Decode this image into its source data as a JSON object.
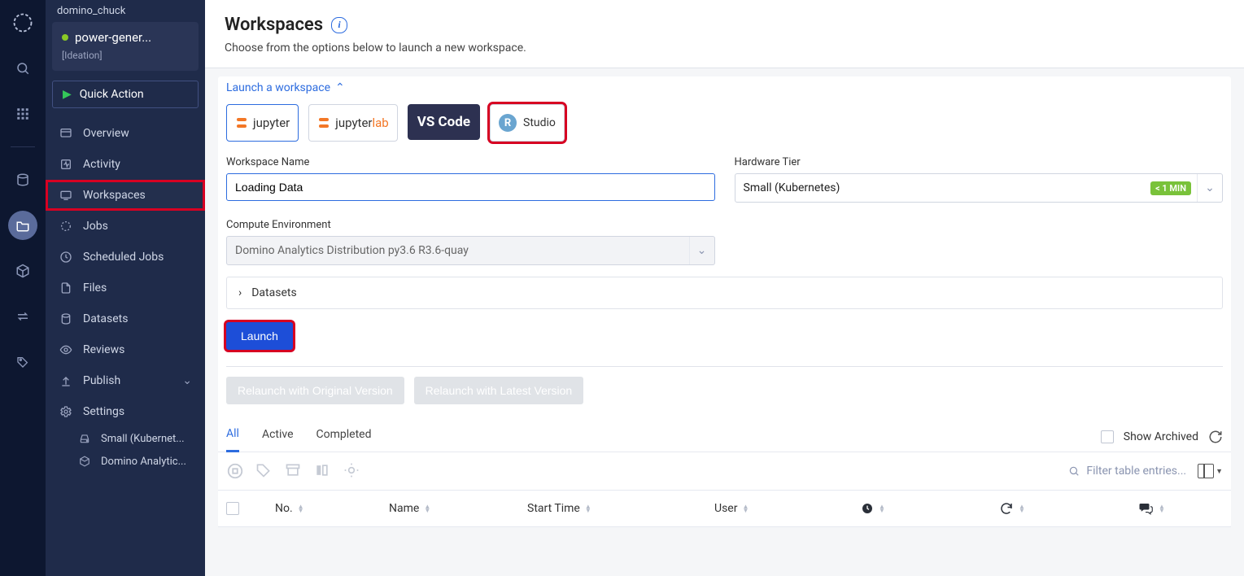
{
  "rail": {
    "icons": [
      "logo",
      "search",
      "grid",
      "db",
      "folder",
      "cube",
      "swap",
      "tag"
    ],
    "active": "folder"
  },
  "user": "domino_chuck",
  "project": {
    "name": "power-gener...",
    "stage": "[Ideation]"
  },
  "quick_action": "Quick Action",
  "side": [
    {
      "key": "overview",
      "icon": "overview",
      "label": "Overview"
    },
    {
      "key": "activity",
      "icon": "activity",
      "label": "Activity"
    },
    {
      "key": "workspaces",
      "icon": "workspace",
      "label": "Workspaces",
      "selected": true,
      "highlighted": true
    },
    {
      "key": "jobs",
      "icon": "jobs",
      "label": "Jobs"
    },
    {
      "key": "scheduled",
      "icon": "clock",
      "label": "Scheduled Jobs"
    },
    {
      "key": "files",
      "icon": "file",
      "label": "Files"
    },
    {
      "key": "datasets",
      "icon": "db",
      "label": "Datasets"
    },
    {
      "key": "reviews",
      "icon": "eye",
      "label": "Reviews"
    },
    {
      "key": "publish",
      "icon": "publish",
      "label": "Publish",
      "chev": true
    },
    {
      "key": "settings",
      "icon": "gear",
      "label": "Settings"
    }
  ],
  "side_sub": [
    {
      "icon": "disk",
      "label": "Small (Kubernet..."
    },
    {
      "icon": "cube",
      "label": "Domino Analytic..."
    }
  ],
  "page": {
    "title": "Workspaces",
    "subtitle": "Choose from the options below to launch a new workspace."
  },
  "launch_link": "Launch a workspace",
  "ides": [
    {
      "key": "jupyter",
      "label": "jupyter",
      "selected": true
    },
    {
      "key": "jupyterlab",
      "label": "jupyterlab"
    },
    {
      "key": "vscode",
      "label": "VS Code"
    },
    {
      "key": "rstudio",
      "label": "Studio",
      "highlighted": true,
      "r": "R"
    }
  ],
  "form": {
    "ws_label": "Workspace Name",
    "ws_value": "Loading Data",
    "hw_label": "Hardware Tier",
    "hw_value": "Small (Kubernetes)",
    "hw_badge": "< 1 MIN",
    "env_label": "Compute Environment",
    "env_value": "Domino Analytics Distribution py3.6 R3.6-quay",
    "datasets": "Datasets",
    "launch": "Launch"
  },
  "relaunch": {
    "orig": "Relaunch with Original Version",
    "latest": "Relaunch with Latest Version"
  },
  "tabs": {
    "all": "All",
    "active": "Active",
    "completed": "Completed",
    "show_archived": "Show Archived"
  },
  "filter_placeholder": "Filter table entries...",
  "columns": {
    "no": "No.",
    "name": "Name",
    "start": "Start Time",
    "user": "User"
  }
}
